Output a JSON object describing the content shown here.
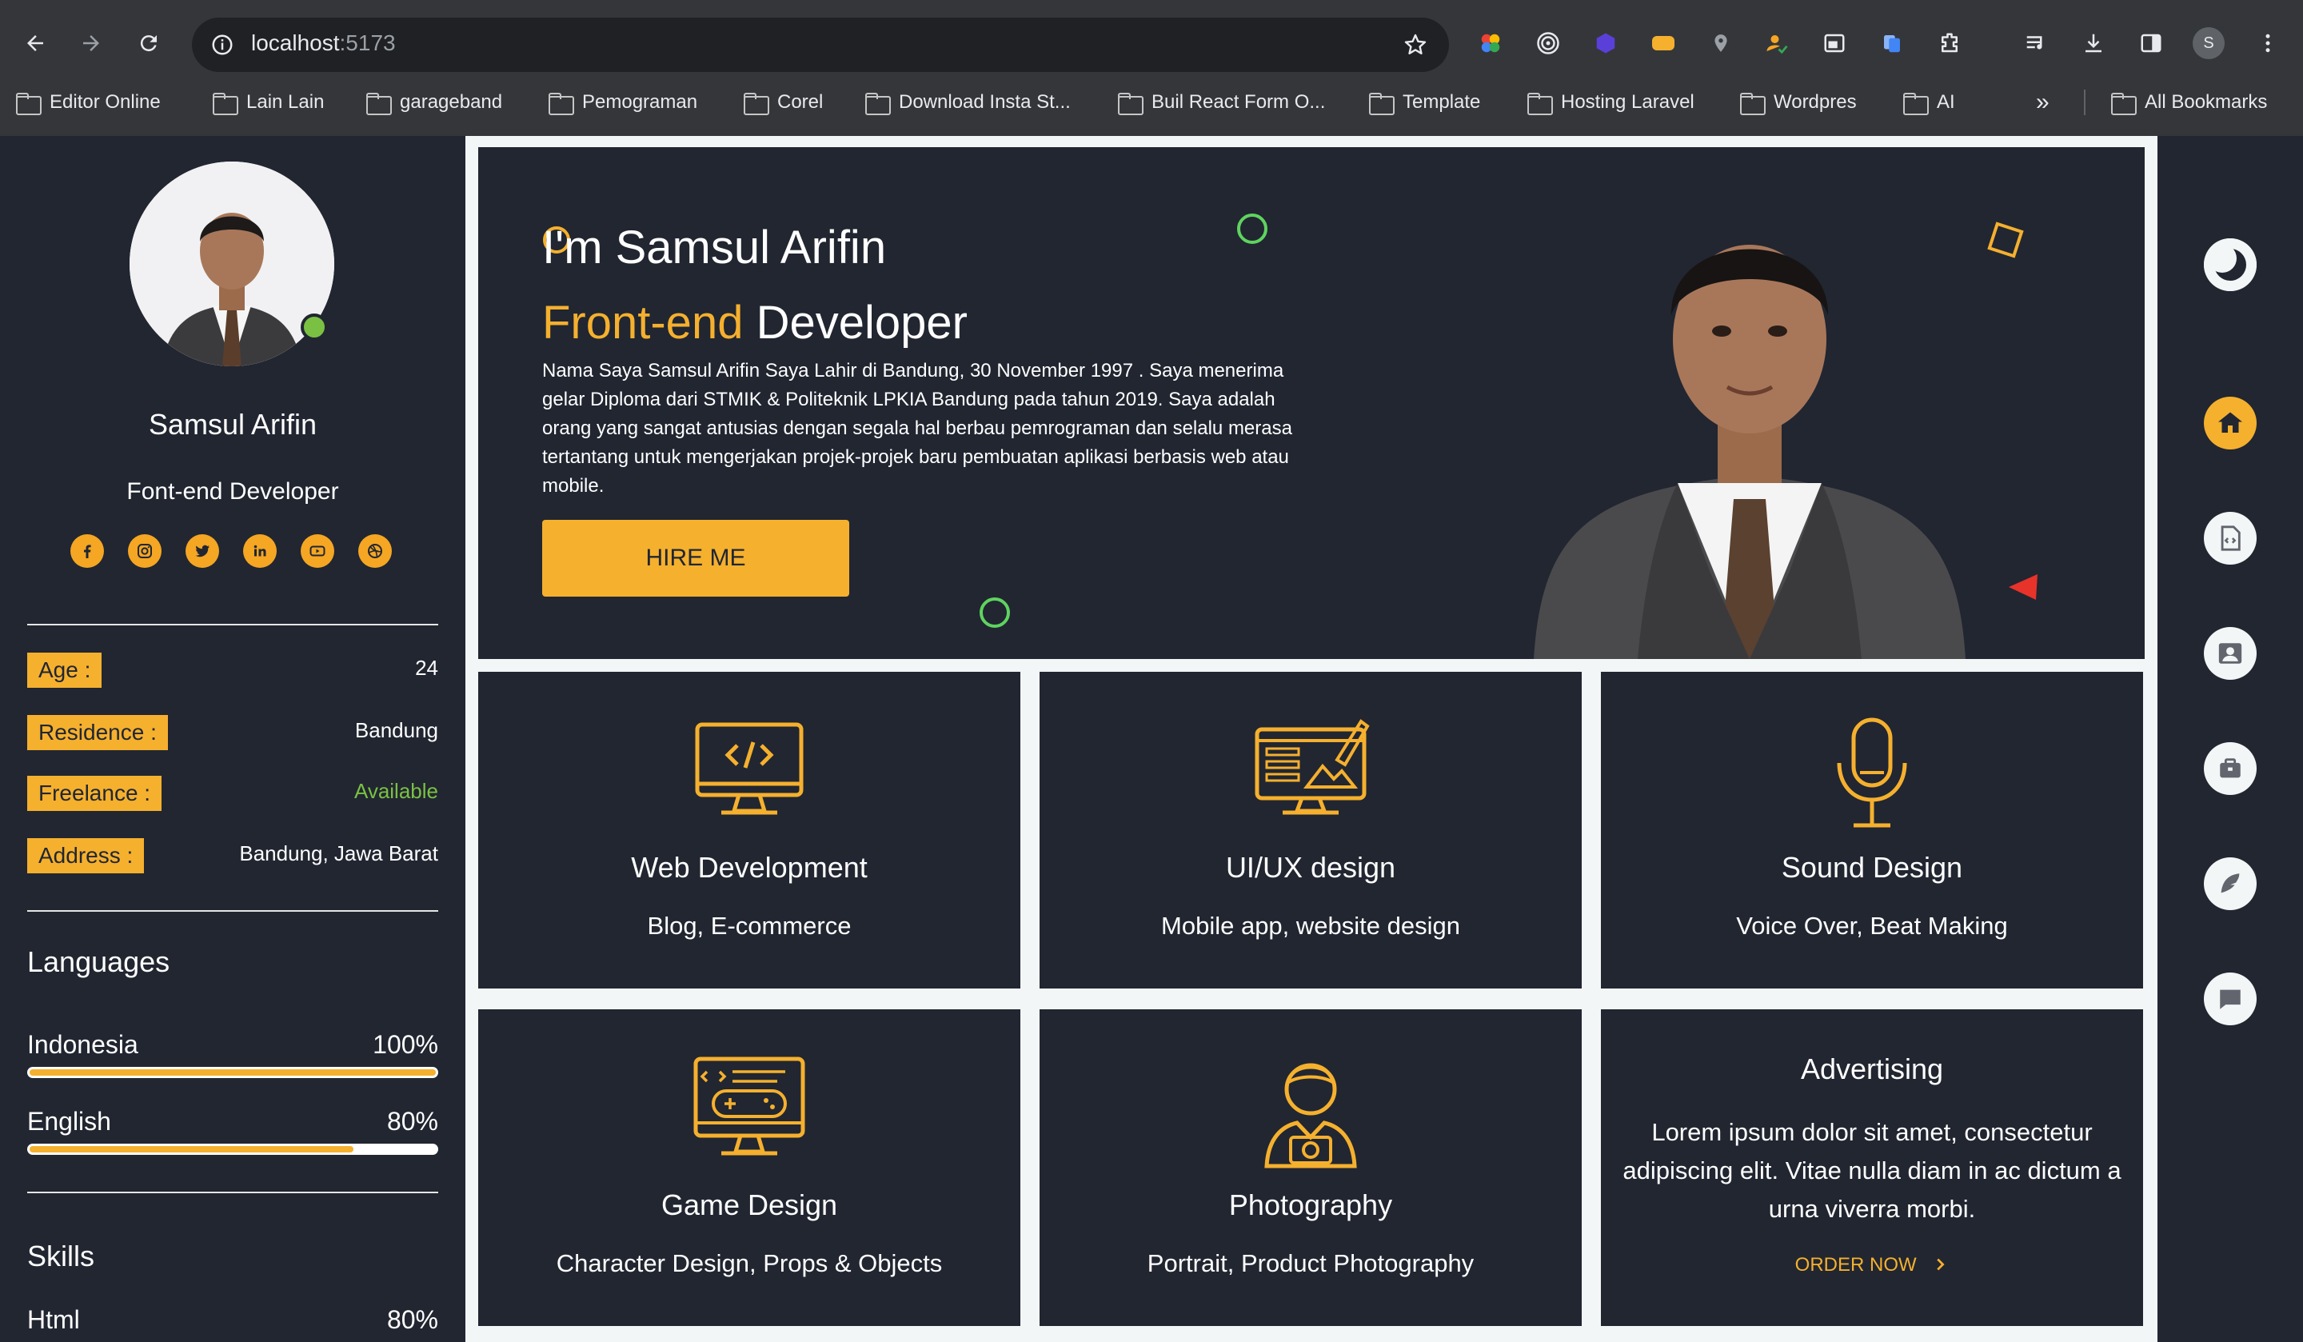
{
  "browser": {
    "url_host": "localhost",
    "url_port": ":5173",
    "profile_initial": "S",
    "bookmarks": [
      "Editor Online",
      "Lain Lain",
      "garageband",
      "Pemograman",
      "Corel",
      "Download Insta St...",
      "Buil React Form O...",
      "Template",
      "Hosting Laravel",
      "Wordpres",
      "AI"
    ],
    "all_bookmarks": "All Bookmarks",
    "overflow": "»"
  },
  "sidebar": {
    "name": "Samsul Arifin",
    "role": "Font-end Developer",
    "socials": [
      "facebook-icon",
      "instagram-icon",
      "twitter-icon",
      "linkedin-icon",
      "youtube-icon",
      "dribbble-icon"
    ],
    "info": [
      {
        "label": "Age :",
        "value": "24"
      },
      {
        "label": "Residence :",
        "value": "Bandung"
      },
      {
        "label": "Freelance :",
        "value": "Available"
      },
      {
        "label": "Address :",
        "value": "Bandung, Jawa Barat"
      }
    ],
    "languages_title": "Languages",
    "languages": [
      {
        "name": "Indonesia",
        "percent": "100%",
        "level": 1.0
      },
      {
        "name": "English",
        "percent": "80%",
        "level": 0.8
      }
    ],
    "skills_title": "Skills",
    "skills": [
      {
        "name": "Html",
        "percent": "80%",
        "level": 0.8
      }
    ]
  },
  "hero": {
    "greeting": "I'm Samsul Arifin",
    "role_accent": "Front-end",
    "role_rest": " Developer",
    "bio": "Nama Saya Samsul Arifin Saya Lahir di Bandung, 30 November 1997 . Saya menerima gelar Diploma dari STMIK & Politeknik LPKIA Bandung pada tahun 2019. Saya adalah orang yang sangat antusias dengan segala hal berbau pemrograman dan selalu merasa tertantang untuk mengerjakan projek-projek baru pembuatan aplikasi berbasis web atau mobile.",
    "hire_label": "HIRE ME"
  },
  "services": [
    {
      "title": "Web Development",
      "subtitle": "Blog, E-commerce",
      "icon": "monitor-code-icon"
    },
    {
      "title": "UI/UX design",
      "subtitle": "Mobile app, website design",
      "icon": "design-monitor-icon"
    },
    {
      "title": "Sound Design",
      "subtitle": "Voice Over, Beat Making",
      "icon": "microphone-icon"
    },
    {
      "title": "Game Design",
      "subtitle": "Character Design, Props & Objects",
      "icon": "gamepad-monitor-icon"
    },
    {
      "title": "Photography",
      "subtitle": "Portrait, Product Photography",
      "icon": "photographer-icon"
    }
  ],
  "advertising": {
    "title": "Advertising",
    "body": "Lorem ipsum dolor sit amet, consectetur adipiscing elit. Vitae nulla diam in ac dictum a urna viverra morbi.",
    "link": "ORDER NOW"
  },
  "rail": {
    "items": [
      "theme-toggle-icon",
      "home-icon",
      "resume-icon",
      "about-icon",
      "portfolio-icon",
      "blog-icon",
      "contact-icon"
    ]
  },
  "colors": {
    "accent": "#f5b02e",
    "panel": "#212631",
    "page_bg": "#f3f6f6",
    "online": "#7ac143"
  }
}
